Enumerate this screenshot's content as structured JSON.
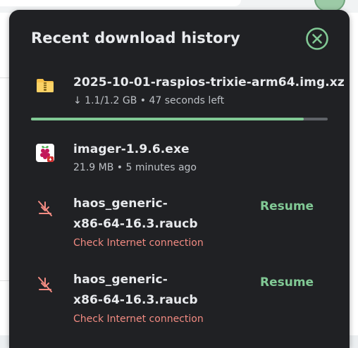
{
  "panel": {
    "title": "Recent download history",
    "close_icon": "close-circle-icon"
  },
  "downloads": [
    {
      "icon": "compressed-folder-icon",
      "filename": "2025-10-01-raspios-trixie-arm64.img.xz",
      "status": "↓ 1.1/1.2 GB • 47 seconds left",
      "progress": 0.92
    },
    {
      "icon": "raspberry-pi-installer-icon",
      "filename": "imager-1.9.6.exe",
      "status": "21.9 MB • 5 minutes ago"
    },
    {
      "icon": "download-failed-icon",
      "filename_line1": "haos_generic-",
      "filename_line2": "x86-64-16.3.raucb",
      "error": "Check Internet connection",
      "action": "Resume"
    },
    {
      "icon": "download-failed-icon",
      "filename_line1": "haos_generic-",
      "filename_line2": "x86-64-16.3.raucb",
      "error": "Check Internet connection",
      "action": "Resume"
    }
  ],
  "colors": {
    "panel_bg": "#202124",
    "progress": "#81c995",
    "resume": "#81c995",
    "error": "#f28b82"
  }
}
